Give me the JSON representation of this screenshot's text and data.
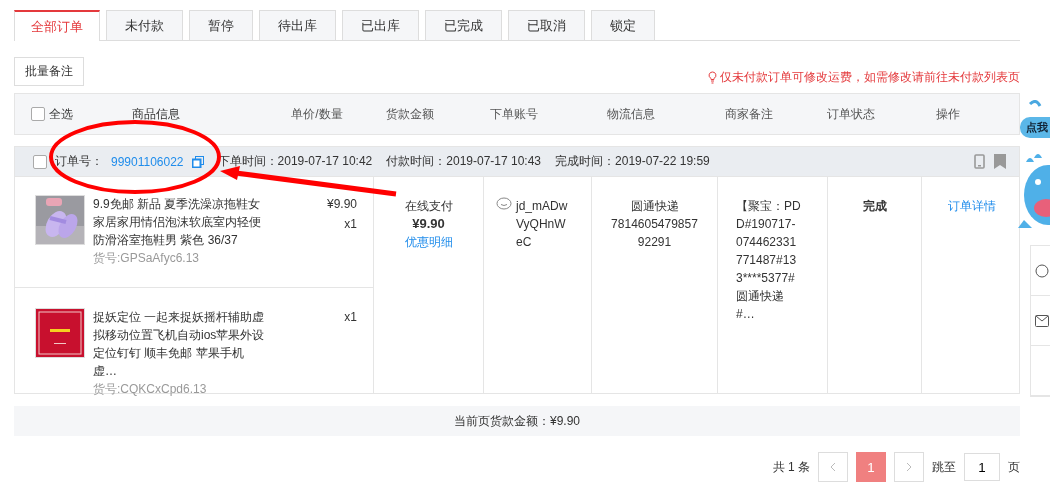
{
  "tabs": [
    {
      "label": "全部订单",
      "selected": true
    },
    {
      "label": "未付款",
      "selected": false
    },
    {
      "label": "暂停",
      "selected": false
    },
    {
      "label": "待出库",
      "selected": false
    },
    {
      "label": "已出库",
      "selected": false
    },
    {
      "label": "已完成",
      "selected": false
    },
    {
      "label": "已取消",
      "selected": false
    },
    {
      "label": "锁定",
      "selected": false
    }
  ],
  "batch_button": "批量备注",
  "notice": "仅未付款订单可修改运费，如需修改请前往未付款列表页",
  "table": {
    "select_all": {
      "label": "全选",
      "checked": false
    },
    "columns": [
      "商品信息",
      "单价/数量",
      "货款金额",
      "下单账号",
      "物流信息",
      "商家备注",
      "订单状态",
      "操作"
    ]
  },
  "order": {
    "checked": false,
    "number_label": "订单号：",
    "number": "99901106022",
    "times": [
      "下单时间：2019-07-17 10:42",
      "付款时间：2019-07-17 10:43",
      "完成时间：2019-07-22 19:59"
    ],
    "items": [
      {
        "kind": "picture",
        "title": "9.9免邮 新品 夏季洗澡凉拖鞋女家居家用情侣泡沫软底室内轻便防滑浴室拖鞋男 紫色 36/37",
        "sku": "货号:GPSaAfyc6.13",
        "price": "¥9.90",
        "qty": "x1"
      },
      {
        "kind": "picture",
        "title": "捉妖定位 一起来捉妖摇杆辅助虚拟移动位置飞机自动ios苹果外设定位钉钉 顺丰免邮 苹果手机虚…",
        "sku": "货号:CQKCxCpd6.13",
        "qty": "x1"
      }
    ],
    "payment": {
      "method": "在线支付",
      "amount": "¥9.90",
      "link": "优惠明细"
    },
    "account": "jd_mADwVyQHnWeC",
    "logistics": {
      "company": "圆通快递",
      "tracking": "781460547985792291"
    },
    "remark": "【聚宝：PDD#190717-074462331771487#133****5377#圆通快递#…",
    "status": "完成",
    "action": "订单详情"
  },
  "total": "当前页货款金额：¥9.90",
  "pagination": {
    "count": "共 1 条",
    "pages": [
      {
        "label": "1",
        "selected": true
      }
    ],
    "jump_label": "跳至",
    "jump_value": "1",
    "unit": "页"
  },
  "help_widget": {
    "label": "点我"
  }
}
